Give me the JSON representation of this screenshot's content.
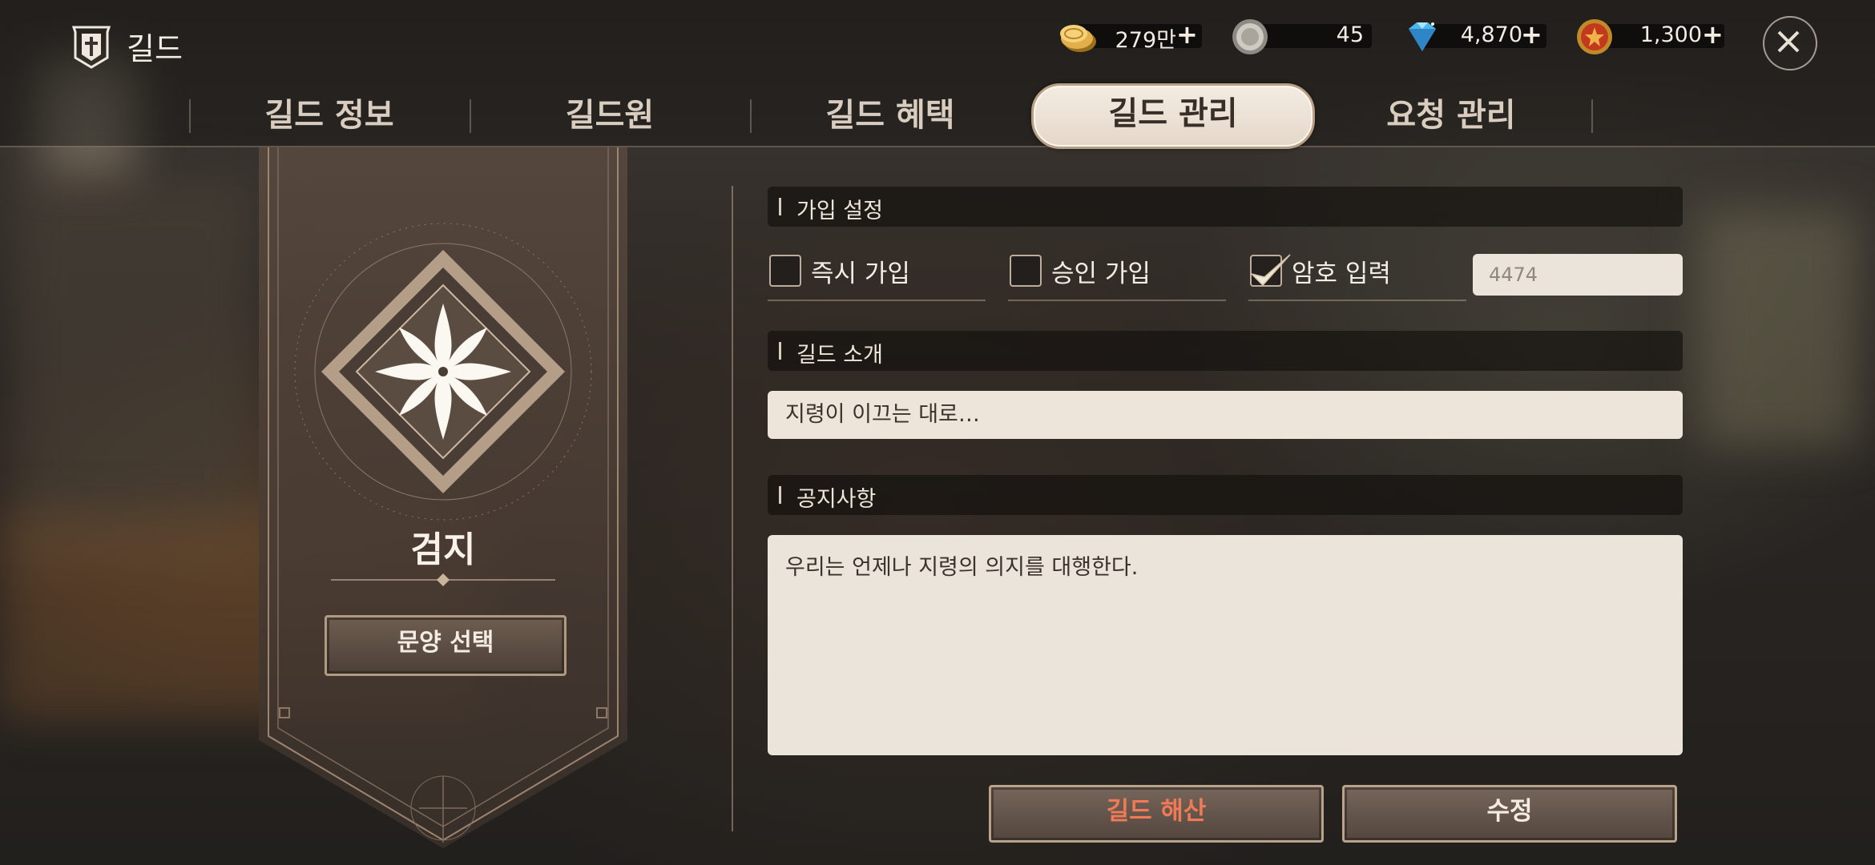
{
  "app": {
    "title": "길드"
  },
  "currencies": [
    {
      "name": "gold",
      "value": "279만",
      "icon": "gold-coins-icon",
      "has_plus": true
    },
    {
      "name": "silver",
      "value": "45",
      "icon": "silver-coin-icon",
      "has_plus": false
    },
    {
      "name": "diamond",
      "value": "4,870",
      "icon": "diamond-icon",
      "has_plus": true
    },
    {
      "name": "ruby",
      "value": "1,300",
      "icon": "red-medal-icon",
      "has_plus": true
    }
  ],
  "plus_symbol": "+",
  "tabs": [
    {
      "label": "길드 정보",
      "active": false
    },
    {
      "label": "길드원",
      "active": false
    },
    {
      "label": "길드 혜택",
      "active": false
    },
    {
      "label": "길드 관리",
      "active": true
    },
    {
      "label": "요청 관리",
      "active": false
    }
  ],
  "guild": {
    "name": "검지",
    "pattern_button": "문양 선택",
    "emblem_icon": "star-flower-emblem-icon"
  },
  "join_settings": {
    "header": "가입 설정",
    "options": [
      {
        "label": "즉시 가입",
        "checked": false
      },
      {
        "label": "승인 가입",
        "checked": false
      },
      {
        "label": "암호 입력",
        "checked": true
      }
    ],
    "password_value": "4474"
  },
  "intro": {
    "header": "길드 소개",
    "text": "지령이 이끄는 대로…"
  },
  "notice": {
    "header": "공지사항",
    "text": "우리는 언제나 지령의 의지를 대행한다."
  },
  "actions": {
    "disband": "길드 해산",
    "edit": "수정"
  },
  "colors": {
    "accent_disband": "#f07a55",
    "active_tab_bg": "#efe6da",
    "gold": "#d9a53c"
  }
}
